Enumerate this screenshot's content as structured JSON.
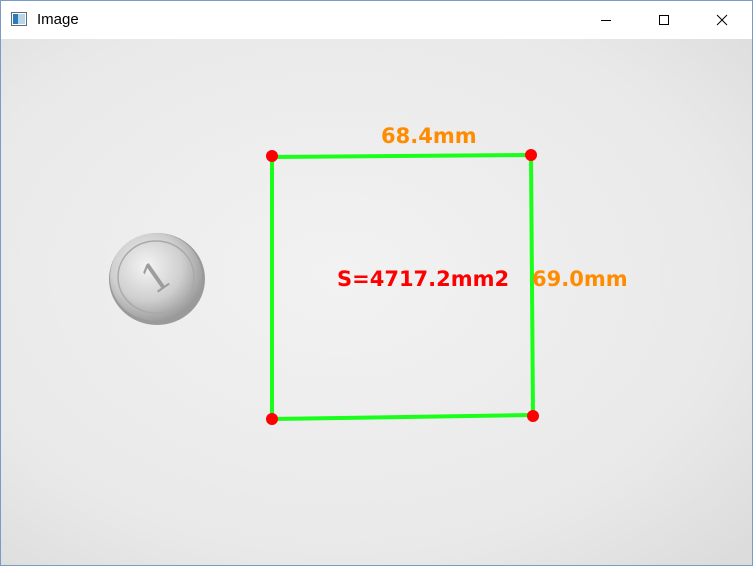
{
  "window": {
    "title": "Image"
  },
  "controls": {
    "minimize_icon": "minimize-icon",
    "maximize_icon": "maximize-icon",
    "close_icon": "close-icon"
  },
  "image": {
    "top_length": "68.4mm",
    "side_length": "69.0mm",
    "area": "S=4717.2mm2",
    "colors": {
      "outline": "#19ff19",
      "corner": "#ff0000",
      "length_label": "#ff8c00",
      "area_label": "#ff0000",
      "paper": "#eeeeee"
    }
  }
}
